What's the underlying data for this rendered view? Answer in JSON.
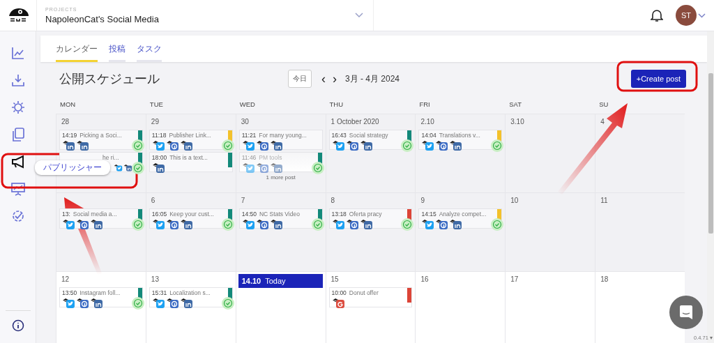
{
  "project": {
    "label": "PROJECTS",
    "name": "NapoleonCat's Social Media"
  },
  "user": {
    "initials": "ST"
  },
  "sidebar": {
    "items": [
      {
        "selected": false
      },
      {
        "selected": false
      },
      {
        "selected": false
      },
      {
        "selected": false
      },
      {
        "selected": true
      },
      {
        "selected": false
      },
      {
        "selected": false
      }
    ],
    "tooltip": "パブリッシャー"
  },
  "tabs": [
    {
      "label": "カレンダー",
      "selected": true
    },
    {
      "label": "投稿",
      "selected": false
    },
    {
      "label": "タスク",
      "selected": false
    }
  ],
  "heading": {
    "title": "公開スケジュール",
    "today_button": "今日",
    "prev": "‹",
    "next": "›",
    "range": "3月 - 4月 2024",
    "create_button": "+Create post"
  },
  "weekdays": [
    "MON",
    "TUE",
    "WED",
    "THU",
    "FRI",
    "SAT",
    "SU"
  ],
  "weeks": [
    {
      "past": true,
      "days": [
        {
          "day": "28",
          "posts": [
            {
              "time": "14:19",
              "title": "Picking a Soci...",
              "networks": [
                {
                  "kind": "linkedin"
                },
                {
                  "kind": "linkedin"
                }
              ],
              "color": "#13897a",
              "approved": true
            },
            {
              "title": "he ri...",
              "networks": [
                {
                  "kind": "twitter"
                },
                {
                  "kind": "linkedin"
                }
              ],
              "color": "#13897a",
              "approved": true
            }
          ]
        },
        {
          "day": "29",
          "posts": [
            {
              "time": "11:18",
              "title": "Publisher Link...",
              "networks": [
                {
                  "kind": "twitter"
                },
                {
                  "kind": "facebook"
                },
                {
                  "kind": "linkedin"
                }
              ],
              "color": "#f3c12b",
              "approved": true
            },
            {
              "time": "18:00",
              "title": "This is a text...",
              "networks": [
                {
                  "kind": "linkedin"
                }
              ],
              "color": "#13897a",
              "approved": false
            }
          ]
        },
        {
          "day": "30",
          "posts": [
            {
              "time": "11:21",
              "title": "For many young...",
              "networks": [
                {
                  "kind": "twitter"
                },
                {
                  "kind": "facebook"
                },
                {
                  "kind": "linkedin"
                }
              ],
              "approved": false
            },
            {
              "time": "11:46",
              "title": "PM tools",
              "networks": [
                {
                  "kind": "twitter"
                },
                {
                  "kind": "facebook"
                },
                {
                  "kind": "linkedin"
                }
              ],
              "color": "#13897a",
              "approved": true,
              "faded": true
            }
          ],
          "more": "1 more post"
        },
        {
          "day": "1 October 2020",
          "posts": [
            {
              "time": "16:43",
              "title": "Social strategy",
              "networks": [
                {
                  "kind": "twitter"
                },
                {
                  "kind": "facebook"
                },
                {
                  "kind": "linkedin"
                }
              ],
              "color": "#13897a",
              "approved": true
            }
          ]
        },
        {
          "day": "2.10",
          "posts": [
            {
              "time": "14:04",
              "title": "Translations v...",
              "networks": [
                {
                  "kind": "twitter"
                },
                {
                  "kind": "facebook"
                },
                {
                  "kind": "linkedin"
                }
              ],
              "color": "#f3c12b",
              "approved": true
            }
          ]
        },
        {
          "day": "3.10"
        },
        {
          "day": "4"
        }
      ]
    },
    {
      "past": true,
      "days": [
        {
          "posts": [
            {
              "time": "13:",
              "title": "Social media a...",
              "networks": [
                {
                  "kind": "twitter"
                },
                {
                  "kind": "facebook"
                },
                {
                  "kind": "linkedin"
                }
              ],
              "color": "#13897a",
              "approved": true
            }
          ]
        },
        {
          "day": "6",
          "posts": [
            {
              "time": "16:05",
              "title": "Keep your cust...",
              "networks": [
                {
                  "kind": "twitter"
                },
                {
                  "kind": "facebook"
                },
                {
                  "kind": "linkedin"
                }
              ],
              "color": "#13897a",
              "approved": true
            }
          ]
        },
        {
          "day": "7",
          "posts": [
            {
              "time": "14:50",
              "title": "NC Stats Video",
              "networks": [
                {
                  "kind": "twitter"
                },
                {
                  "kind": "facebook"
                },
                {
                  "kind": "linkedin"
                }
              ],
              "color": "#13897a",
              "approved": true
            }
          ]
        },
        {
          "day": "8",
          "posts": [
            {
              "time": "13:18",
              "title": "Oferta pracy",
              "networks": [
                {
                  "kind": "twitter"
                },
                {
                  "kind": "facebook"
                },
                {
                  "kind": "linkedin"
                }
              ],
              "color": "#dc4437",
              "approved": true
            }
          ]
        },
        {
          "day": "9",
          "posts": [
            {
              "time": "14:15",
              "title": "Analyze compet...",
              "networks": [
                {
                  "kind": "twitter"
                },
                {
                  "kind": "facebook"
                },
                {
                  "kind": "linkedin"
                }
              ],
              "color": "#f3c12b",
              "approved": true
            }
          ]
        },
        {
          "day": "10"
        },
        {
          "day": "11"
        }
      ]
    },
    {
      "past": false,
      "days": [
        {
          "day": "12",
          "posts": [
            {
              "time": "13:50",
              "title": "Instagram foll...",
              "networks": [
                {
                  "kind": "twitter"
                },
                {
                  "kind": "facebook"
                },
                {
                  "kind": "linkedin"
                }
              ],
              "color": "#13897a",
              "approved": true
            }
          ]
        },
        {
          "day": "13",
          "posts": [
            {
              "time": "15:31",
              "title": "Localization s...",
              "networks": [
                {
                  "kind": "twitter"
                },
                {
                  "kind": "facebook"
                },
                {
                  "kind": "linkedin"
                }
              ],
              "color": "#13897a",
              "approved": true
            }
          ]
        },
        {
          "today": {
            "date": "14.10",
            "label": "Today"
          }
        },
        {
          "day": "15",
          "posts": [
            {
              "time": "10:00",
              "title": "Donut offer",
              "networks": [
                {
                  "kind": "google"
                }
              ],
              "color": "#dc4437",
              "approved": false
            }
          ]
        },
        {
          "day": "16"
        },
        {
          "day": "17"
        },
        {
          "day": "18"
        }
      ]
    }
  ],
  "version": "0.4.71 ▾"
}
